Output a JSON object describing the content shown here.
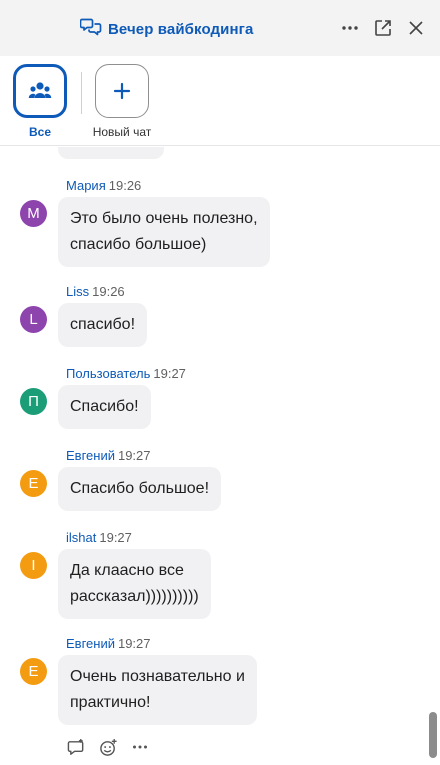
{
  "window": {
    "title": "Вечер вайбкодинга",
    "more_icon": "more-horizontal-icon",
    "popout_icon": "pop-out-icon",
    "close_icon": "close-icon"
  },
  "tabs": [
    {
      "label": "Все",
      "icon": "people-icon",
      "active": true
    },
    {
      "label": "Новый чат",
      "icon": "plus-icon",
      "active": false
    }
  ],
  "messages": [
    {
      "sender": "Мария",
      "time": "19:26",
      "initial": "М",
      "avatar_color": "#8e44ad",
      "text": "Это было очень полезно,\nспасибо большое)"
    },
    {
      "sender": "Liss",
      "time": "19:26",
      "initial": "L",
      "avatar_color": "#8e44ad",
      "text": "спасибо!"
    },
    {
      "sender": "Пользователь",
      "time": "19:27",
      "initial": "П",
      "avatar_color": "#1b9e77",
      "text": "Спасибо!"
    },
    {
      "sender": "Евгений",
      "time": "19:27",
      "initial": "Е",
      "avatar_color": "#f39c12",
      "text": "Спасибо большое!"
    },
    {
      "sender": "ilshat",
      "time": "19:27",
      "initial": "I",
      "avatar_color": "#f39c12",
      "text": "Да клаасно все\nрассказал))))))))))"
    },
    {
      "sender": "Евгений",
      "time": "19:27",
      "initial": "Е",
      "avatar_color": "#f39c12",
      "text": "Очень познавательно и\nпрактично!"
    }
  ],
  "message_actions": [
    "reply-icon",
    "add-reaction-icon",
    "more-horizontal-icon"
  ],
  "colors": {
    "accent": "#0e5ab8",
    "bubble": "#f1f1f3",
    "titlebar": "#f3f3f3"
  }
}
